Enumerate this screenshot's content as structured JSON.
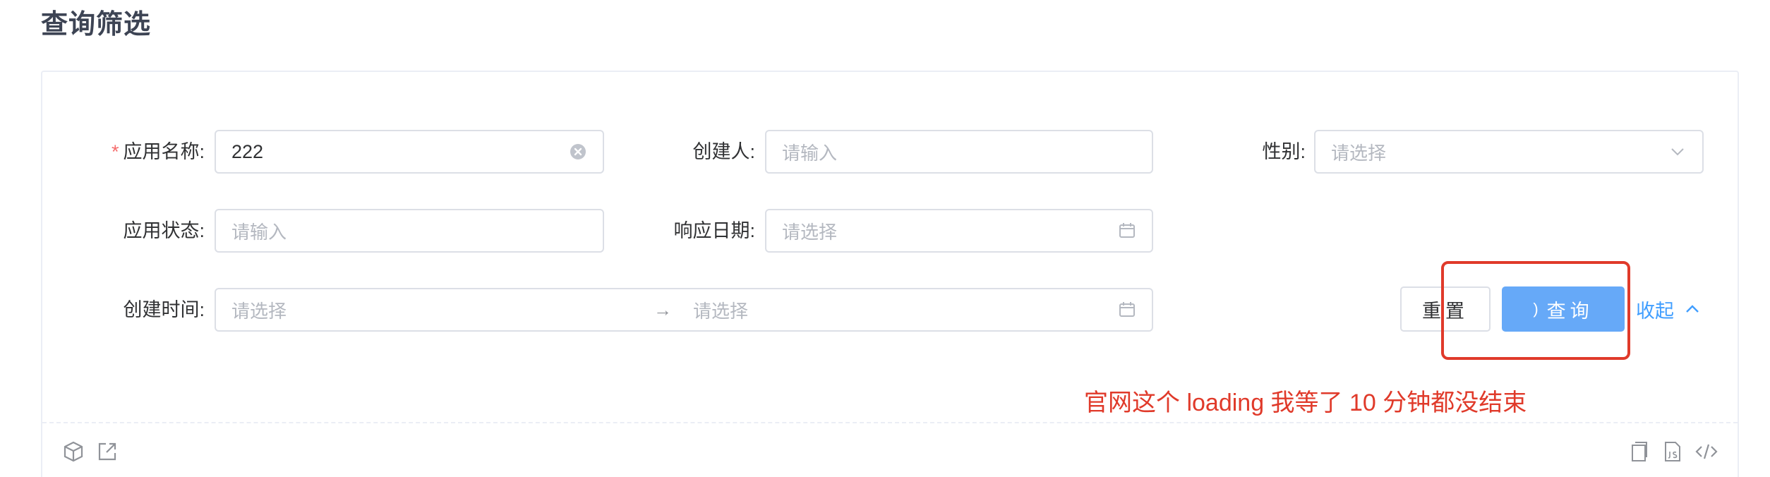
{
  "header": {
    "title": "查询筛选"
  },
  "form": {
    "app_name": {
      "label": "应用名称:",
      "required_mark": "*",
      "value": "222"
    },
    "creator": {
      "label": "创建人:",
      "placeholder": "请输入"
    },
    "gender": {
      "label": "性别:",
      "placeholder": "请选择"
    },
    "app_status": {
      "label": "应用状态:",
      "placeholder": "请输入"
    },
    "response_date": {
      "label": "响应日期:",
      "placeholder": "请选择"
    },
    "create_time": {
      "label": "创建时间:",
      "start_placeholder": "请选择",
      "separator": "→",
      "end_placeholder": "请选择"
    }
  },
  "actions": {
    "reset_label": "重置",
    "query_label": "查询",
    "loading_glyph": ")",
    "collapse_label": "收起"
  },
  "annotation": {
    "text": "官网这个 loading 我等了 10 分钟都没结束"
  },
  "colors": {
    "primary": "#409eff",
    "primary_loading": "#66a9f8",
    "annotation": "#e03a2a",
    "required": "#f56c6c"
  },
  "footer": {
    "icons": [
      "cube-icon",
      "open-external-icon",
      "copy-icon",
      "js-file-icon",
      "code-icon"
    ]
  }
}
